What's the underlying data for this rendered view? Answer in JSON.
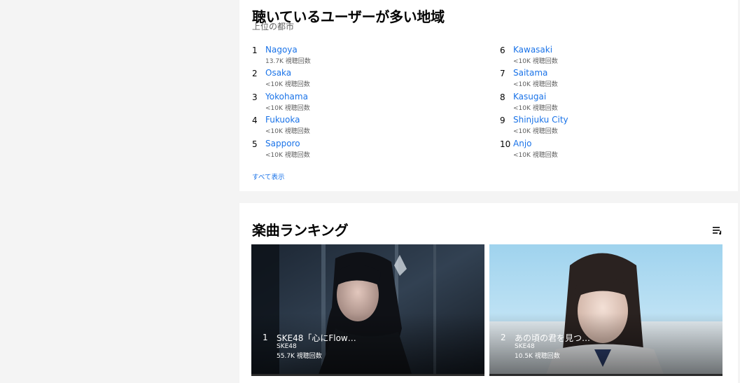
{
  "cities_card": {
    "title": "聴いているユーザーが多い地域",
    "subtitle": "上位の都市",
    "show_all": "すべて表示",
    "cities_left": [
      {
        "rank": "1",
        "name": "Nagoya",
        "views": "13.7K 視聴回数"
      },
      {
        "rank": "2",
        "name": "Osaka",
        "views": "<10K 視聴回数"
      },
      {
        "rank": "3",
        "name": "Yokohama",
        "views": "<10K 視聴回数"
      },
      {
        "rank": "4",
        "name": "Fukuoka",
        "views": "<10K 視聴回数"
      },
      {
        "rank": "5",
        "name": "Sapporo",
        "views": "<10K 視聴回数"
      }
    ],
    "cities_right": [
      {
        "rank": "6",
        "name": "Kawasaki",
        "views": "<10K 視聴回数"
      },
      {
        "rank": "7",
        "name": "Saitama",
        "views": "<10K 視聴回数"
      },
      {
        "rank": "8",
        "name": "Kasugai",
        "views": "<10K 視聴回数"
      },
      {
        "rank": "9",
        "name": "Shinjuku City",
        "views": "<10K 視聴回数"
      },
      {
        "rank": "10",
        "name": "Anjo",
        "views": "<10K 視聴回数"
      }
    ]
  },
  "songs_card": {
    "title": "楽曲ランキング",
    "list_icon": "playlist-icon",
    "songs": [
      {
        "rank": "1",
        "title": "SKE48「心にFlow…",
        "artist": "SKE48",
        "plays": "55.7K 視聴回数"
      },
      {
        "rank": "2",
        "title": "あの頃の君を見つ…",
        "artist": "SKE48",
        "plays": "10.5K 視聴回数"
      }
    ]
  },
  "colors": {
    "link": "#1a73e8",
    "background": "#f4f4f4",
    "card": "#ffffff"
  }
}
